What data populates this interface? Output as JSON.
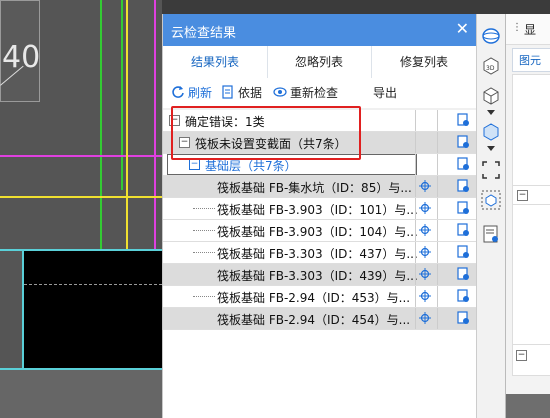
{
  "canvas": {
    "text": "40"
  },
  "panel": {
    "title": "云检查结果",
    "close_label": "✕",
    "tabs": [
      {
        "label": "结果列表",
        "active": true
      },
      {
        "label": "忽略列表",
        "active": false
      },
      {
        "label": "修复列表",
        "active": false
      }
    ],
    "toolbar": {
      "refresh": "刷新",
      "basis": "依据",
      "recheck": "重新检查",
      "export": "导出"
    },
    "tree": {
      "root": "确定错误：1类",
      "category": "筏板未设置变截面（共7条）",
      "group": "基础层（共7条）",
      "items": [
        "筏板基础 FB-集水坑（ID：85）与...",
        "筏板基础 FB-3.903（ID：101）与...",
        "筏板基础 FB-3.903（ID：104）与...",
        "筏板基础 FB-3.303（ID：437）与...",
        "筏板基础 FB-3.303（ID：439）与...",
        "筏板基础 FB-2.94（ID：453）与...",
        "筏板基础 FB-2.94（ID：454）与..."
      ]
    }
  },
  "right_panel": {
    "label": "显",
    "sub_label": "图元"
  },
  "colors": {
    "title_bar": "#4a8de0",
    "active_tab": "#1565c0",
    "highlight_box": "#e02020",
    "link_blue": "#1e6fd9"
  },
  "icons": {
    "refresh": "refresh-icon",
    "basis": "document-icon",
    "recheck": "eye-icon",
    "locate": "crosshair-icon",
    "fix": "fix-document-icon"
  }
}
